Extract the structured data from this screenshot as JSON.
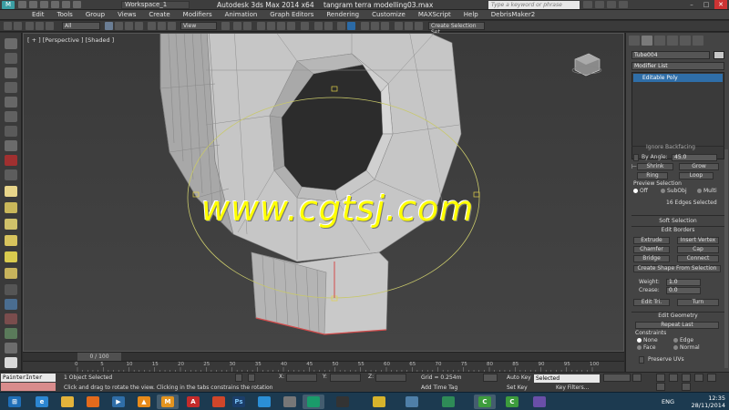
{
  "titlebar": {
    "logo": "M",
    "workspace": "Workspace_1",
    "app_title": "Autodesk 3ds Max  2014 x64",
    "file_title": "tangram terra modelling03.max",
    "search_placeholder": "Type a keyword or phrase"
  },
  "menu": [
    "Edit",
    "Tools",
    "Group",
    "Views",
    "Create",
    "Modifiers",
    "Animation",
    "Graph Editors",
    "Rendering",
    "Customize",
    "MAXScript",
    "Help",
    "DebrisMaker2"
  ],
  "toolbar": {
    "filter": "All",
    "ref_coord": "View",
    "selection_set": "Create Selection Set"
  },
  "viewport": {
    "label": "[ + ] [Perspective ] [Shaded ]",
    "watermark": "www.cgtsj.com"
  },
  "timeline": {
    "frame": "0 / 100",
    "ticks": [
      "0",
      "5",
      "10",
      "15",
      "20",
      "25",
      "30",
      "35",
      "40",
      "45",
      "50",
      "55",
      "60",
      "65",
      "70",
      "75",
      "80",
      "85",
      "90",
      "95",
      "100"
    ]
  },
  "status": {
    "script_listener": "PainterInter",
    "selection_info": "1 Object Selected",
    "prompt": "Click and drag to rotate the view.  Clicking in the tabs constrains the rotation",
    "x_label": "X:",
    "y_label": "Y:",
    "z_label": "Z:",
    "grid": "Grid = 0.254m",
    "add_time_tag": "Add Time Tag",
    "auto_key": "Auto Key",
    "set_key": "Set Key",
    "selected": "Selected",
    "key_filters": "Key Filters..."
  },
  "command_panel": {
    "object_name": "Tube004",
    "modifier_list": "Modifier List",
    "stack_item": "Editable Poly",
    "ignore_backfacing": "Ignore Backfacing",
    "by_angle": "By Angle:",
    "by_angle_value": "45.0",
    "shrink": "Shrink",
    "grow": "Grow",
    "ring": "Ring",
    "loop": "Loop",
    "preview_selection": "Preview Selection",
    "off": "Off",
    "subobj": "SubObj",
    "multi": "Multi",
    "edges_selected": "16 Edges Selected",
    "soft_selection": "Soft Selection",
    "edit_borders": "Edit Borders",
    "extrude": "Extrude",
    "insert_vertex": "Insert Vertex",
    "chamfer": "Chamfer",
    "cap": "Cap",
    "bridge": "Bridge",
    "connect": "Connect",
    "create_shape": "Create Shape From Selection",
    "weight_label": "Weight:",
    "weight_value": "1.0",
    "crease_label": "Crease:",
    "crease_value": "0.0",
    "edit_tri": "Edit Tri.",
    "turn": "Turn",
    "edit_geometry": "Edit Geometry",
    "repeat_last": "Repeat Last",
    "constraints": "Constraints",
    "none": "None",
    "edge": "Edge",
    "face": "Face",
    "normal": "Normal",
    "preserve_uvs": "Preserve UVs"
  },
  "taskbar": {
    "lang": "ENG",
    "time": "12:35",
    "date": "28/11/2014"
  }
}
